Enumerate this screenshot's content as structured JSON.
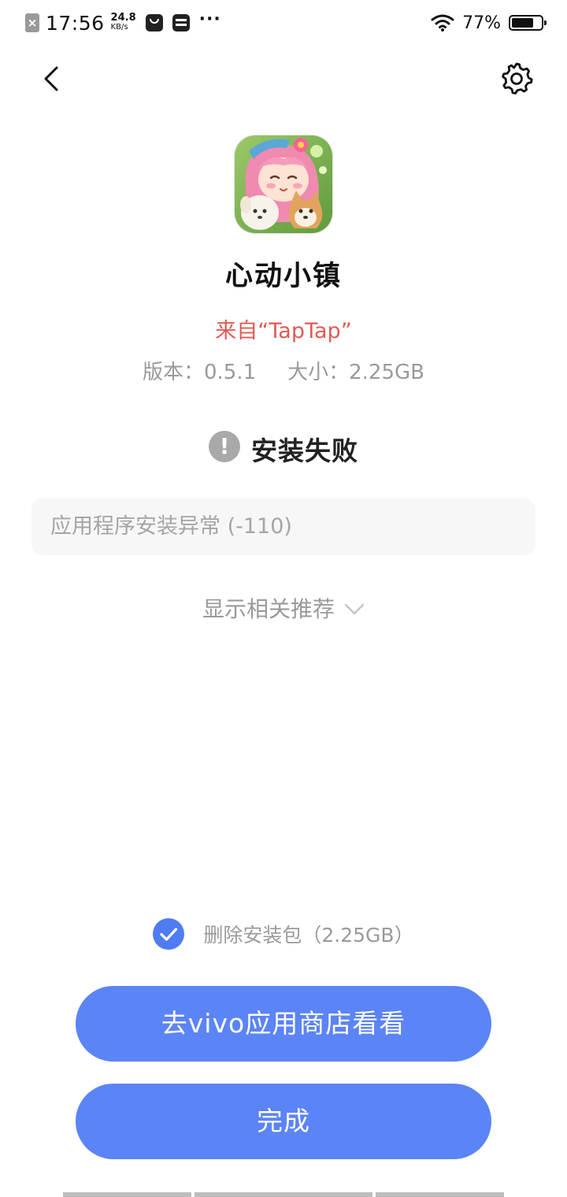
{
  "status_bar": {
    "time": "17:56",
    "net_speed_value": "24.8",
    "net_speed_unit": "KB/s",
    "more": "···",
    "battery_percent": "77%",
    "battery_level": 0.77
  },
  "nav": {
    "back_icon": "chevron-left-icon",
    "settings_icon": "gear-icon"
  },
  "app": {
    "name": "心动小镇",
    "source": "来自“TapTap”",
    "version": "版本：0.5.1",
    "size": "大小：2.25GB"
  },
  "result": {
    "title": "安装失败",
    "error_message": "应用程序安装异常 (-110)",
    "recommend_toggle": "显示相关推荐"
  },
  "options": {
    "delete_package": "删除安装包（2.25GB）",
    "delete_package_checked": true
  },
  "buttons": {
    "store": "去vivo应用商店看看",
    "done": "完成"
  },
  "colors": {
    "accent": "#5b84f6",
    "source_red": "#e05a55",
    "muted_text": "#9a9a9a"
  }
}
